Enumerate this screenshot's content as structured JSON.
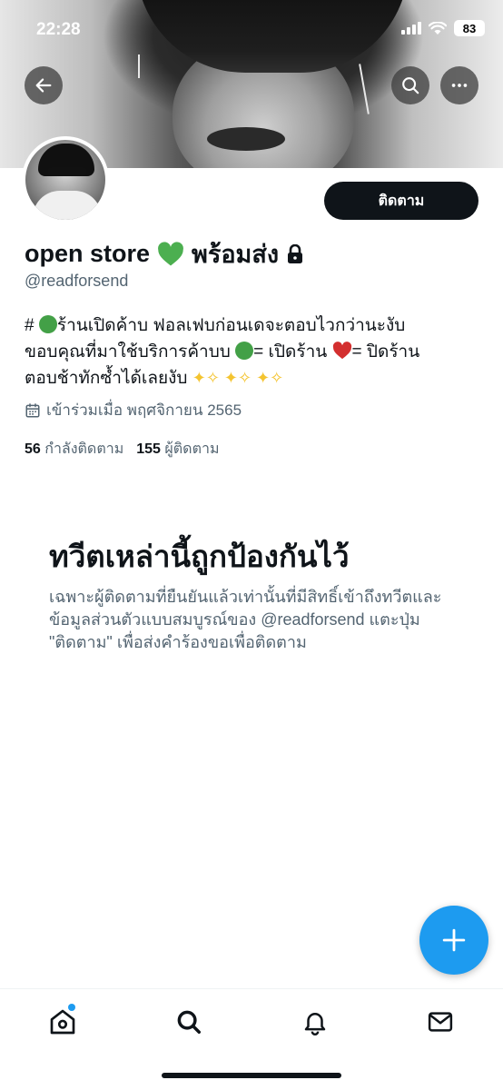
{
  "status_bar": {
    "time": "22:28",
    "battery": "83"
  },
  "profile": {
    "display_name": "open store",
    "display_name_suffix": "พร้อมส่ง",
    "handle": "@readforsend",
    "follow_label": "ติดตาม",
    "bio_line1": "ร้านเปิดค้าบ ฟอลเฟบก่อนเดจะตอบไวกว่านะงับ",
    "bio_line2_a": "ขอบคุณที่มาใช้บริการค้าบบ",
    "bio_line2_b": "= เปิดร้าน",
    "bio_line2_c": "= ปิดร้าน",
    "bio_line3": "ตอบช้าทักซ้ำได้เลยงับ",
    "bio_hash": "#",
    "joined": "เข้าร่วมเมื่อ พฤศจิกายน 2565",
    "following_count": "56",
    "following_label": "กำลังติดตาม",
    "followers_count": "155",
    "followers_label": "ผู้ติดตาม"
  },
  "protected": {
    "title": "ทวีตเหล่านี้ถูกป้องกันไว้",
    "description": "เฉพาะผู้ติดตามที่ยืนยันแล้วเท่านั้นที่มีสิทธิ์เข้าถึงทวีตและข้อมูลส่วนตัวแบบสมบูรณ์ของ @readforsend แตะปุ่ม \"ติดตาม\" เพื่อส่งคำร้องขอเพื่อติดตาม"
  },
  "colors": {
    "accent": "#1d9bf0",
    "text_primary": "#0f1419",
    "text_secondary": "#536471",
    "green_heart": "#4caf50",
    "red_heart": "#d32f2f"
  },
  "icons": {
    "back": "arrow-left-icon",
    "search": "search-icon",
    "more": "more-horizontal-icon",
    "lock": "lock-icon",
    "calendar": "calendar-icon",
    "compose": "plus-icon",
    "nav": [
      "home-icon",
      "search-icon",
      "bell-icon",
      "mail-icon"
    ]
  }
}
